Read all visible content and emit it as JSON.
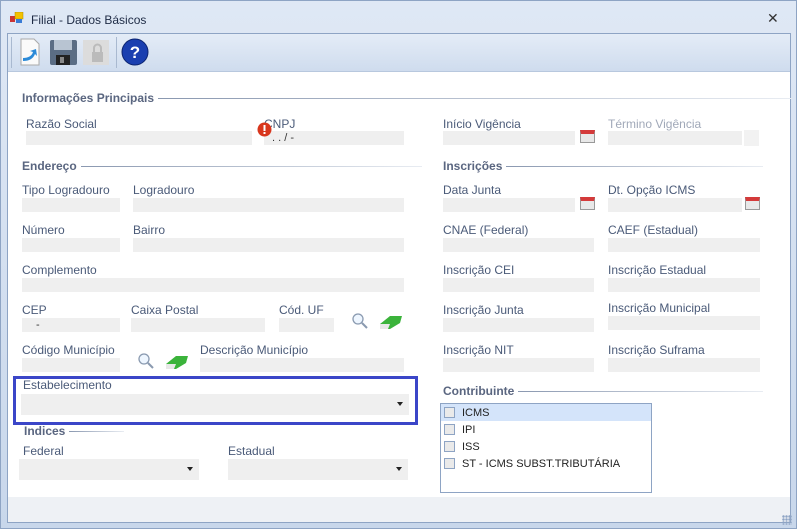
{
  "window": {
    "title": "Filial - Dados Básicos",
    "close": "✕"
  },
  "toolbar": {
    "buttons": [
      "new-icon",
      "save-icon",
      "lock-icon",
      "help-icon"
    ],
    "help_glyph": "?"
  },
  "sections": {
    "principais": "Informações Principais",
    "endereco": "Endereço",
    "inscricoes": "Inscrições",
    "contribuinte": "Contribuinte",
    "indices": "Indices"
  },
  "principais": {
    "razao_social": "Razão Social",
    "cnpj": "CNPJ",
    "cnpj_mask": ".  .  /   -",
    "inicio": "Início Vigência",
    "termino": "Término Vigência"
  },
  "endereco": {
    "tipo_logradouro": "Tipo Logradouro",
    "logradouro": "Logradouro",
    "numero": "Número",
    "bairro": "Bairro",
    "complemento": "Complemento",
    "cep": "CEP",
    "cep_mask": "-",
    "caixa_postal": "Caixa Postal",
    "cod_uf": "Cód. UF",
    "cod_municipio": "Código Município",
    "desc_municipio": "Descrição Município",
    "estabelecimento": "Estabelecimento"
  },
  "inscricoes": {
    "data_junta": "Data Junta",
    "dt_opcao_icms": "Dt. Opção ICMS",
    "cnae": "CNAE (Federal)",
    "caef": "CAEF (Estadual)",
    "cei": "Inscrição CEI",
    "estadual": "Inscrição Estadual",
    "junta": "Inscrição Junta",
    "municipal": "Inscrição Municipal",
    "nit": "Inscrição NIT",
    "suframa": "Inscrição Suframa"
  },
  "contribuinte": {
    "items": [
      "ICMS",
      "IPI",
      "ISS",
      "ST - ICMS SUBST.TRIBUTÁRIA"
    ]
  },
  "indices": {
    "federal": "Federal",
    "estadual": "Estadual"
  },
  "colors": {
    "accent": "#3b46c8",
    "field": "#efefef"
  }
}
